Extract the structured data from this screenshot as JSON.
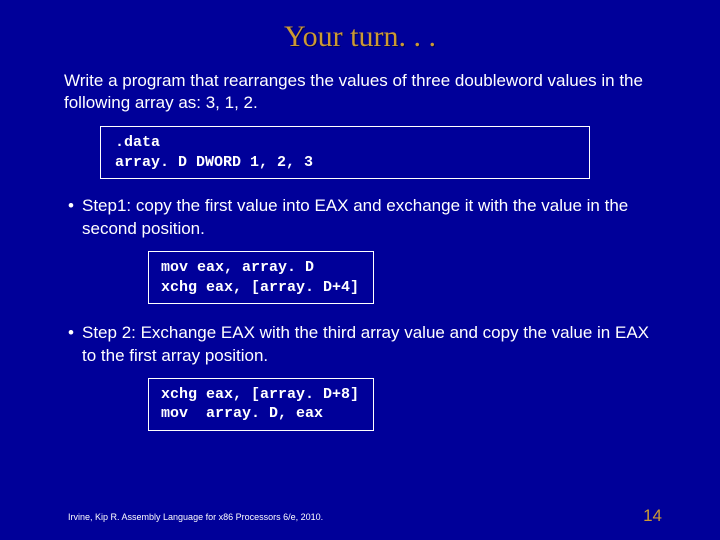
{
  "title": "Your turn. . .",
  "intro": "Write a program that rearranges the values of three doubleword values in the following array as: 3, 1, 2.",
  "code1": ".data\narray. D DWORD 1, 2, 3",
  "step1": "Step1: copy the first value into EAX and exchange it with the value in the second position.",
  "code2": "mov eax, array. D\nxchg eax, [array. D+4]",
  "step2": "Step 2: Exchange EAX with the third array value and copy the value in EAX to the first array position.",
  "code3": "xchg eax, [array. D+8]\nmov  array. D, eax",
  "footer": "Irvine, Kip R. Assembly Language for x86 Processors 6/e, 2010.",
  "pagenum": "14"
}
